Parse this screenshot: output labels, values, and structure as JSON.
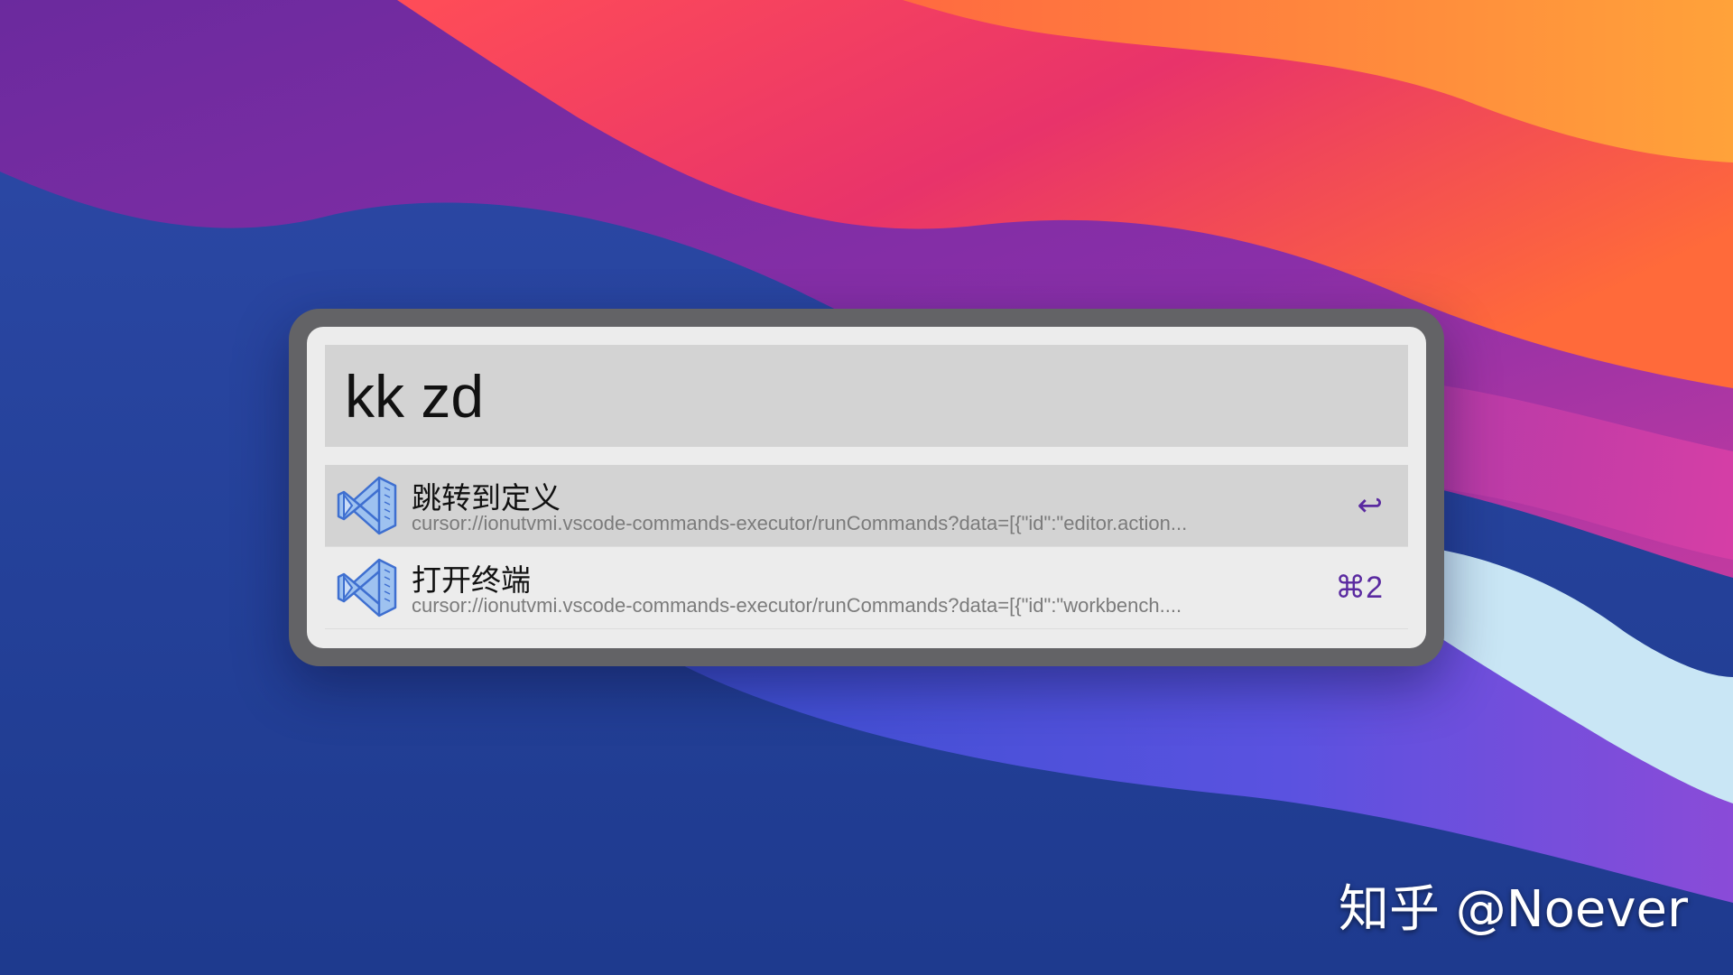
{
  "search": {
    "query": "kk zd"
  },
  "results": [
    {
      "title": "跳转到定义",
      "subtitle": "cursor://ionutvmi.vscode-commands-executor/runCommands?data=[{\"id\":\"editor.action...",
      "shortcut": "↩",
      "icon": "vscode-icon",
      "selected": true
    },
    {
      "title": "打开终端",
      "subtitle": "cursor://ionutvmi.vscode-commands-executor/runCommands?data=[{\"id\":\"workbench....",
      "shortcut": "⌘2",
      "icon": "vscode-icon",
      "selected": false
    }
  ],
  "watermark": "知乎 @Noever",
  "colors": {
    "frame": "#636366",
    "panel": "#ececec",
    "selected_row": "#d3d3d3",
    "shortcut_accent": "#5a2aa0"
  }
}
